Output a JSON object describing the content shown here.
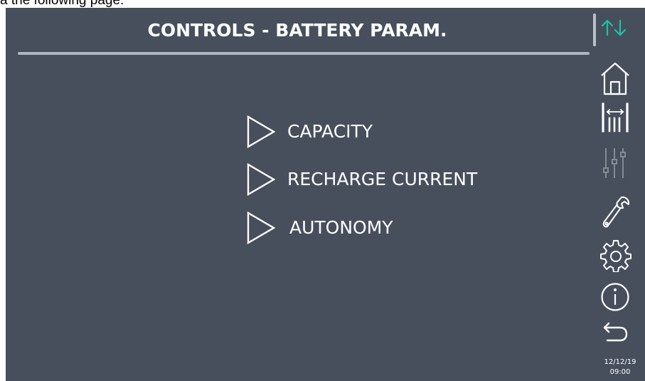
{
  "caption": {
    "text": "a the following page:"
  },
  "header": {
    "title": "CONTROLS - BATTERY  PARAM."
  },
  "menu": {
    "items": [
      {
        "label": "CAPACITY"
      },
      {
        "label": "RECHARGE CURRENT"
      },
      {
        "label": "AUTONOMY"
      }
    ]
  },
  "sidebar": {
    "icons": [
      "home-icon",
      "measurements-icon",
      "settings-sliders-icon",
      "wrench-icon",
      "gear-icon",
      "info-icon",
      "back-icon"
    ]
  },
  "status": {
    "date": "12/12/19",
    "time": "09:00"
  },
  "colors": {
    "screen_background": "#474f5d",
    "text": "#ffffff",
    "accent_arrows": "#19c4a6",
    "disabled_icon": "#858b95"
  }
}
